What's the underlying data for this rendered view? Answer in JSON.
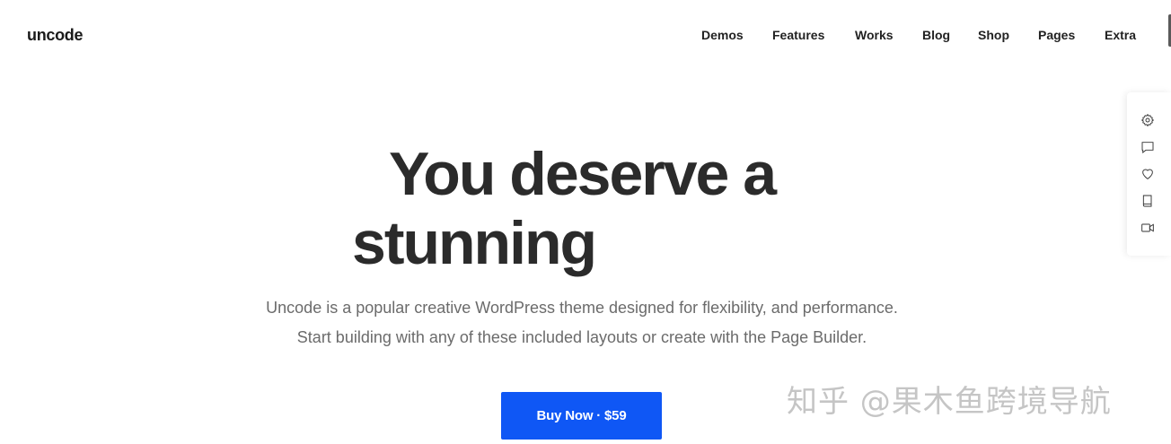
{
  "header": {
    "logo": "uncode",
    "nav": [
      {
        "label": "Demos"
      },
      {
        "label": "Features"
      },
      {
        "label": "Works"
      },
      {
        "label": "Blog"
      },
      {
        "label": "Shop"
      },
      {
        "label": "Pages"
      },
      {
        "label": "Extra"
      }
    ]
  },
  "sidebar": {
    "icons": [
      "gear-icon",
      "comment-icon",
      "heart-icon",
      "book-icon",
      "video-icon"
    ]
  },
  "hero": {
    "headline_line1": "You deserve a",
    "headline_line2": "stunning",
    "subtitle_line1": "Uncode is a popular creative WordPress theme designed for flexibility, and performance.",
    "subtitle_line2": "Start building with any of these included layouts or create with the Page Builder.",
    "cta_label": "Buy Now · $59"
  },
  "watermark": {
    "text": "知乎 @果木鱼跨境导航"
  },
  "colors": {
    "accent": "#0f57f5",
    "headline": "#2b2b2b",
    "subtitle": "#6b6b6b"
  }
}
